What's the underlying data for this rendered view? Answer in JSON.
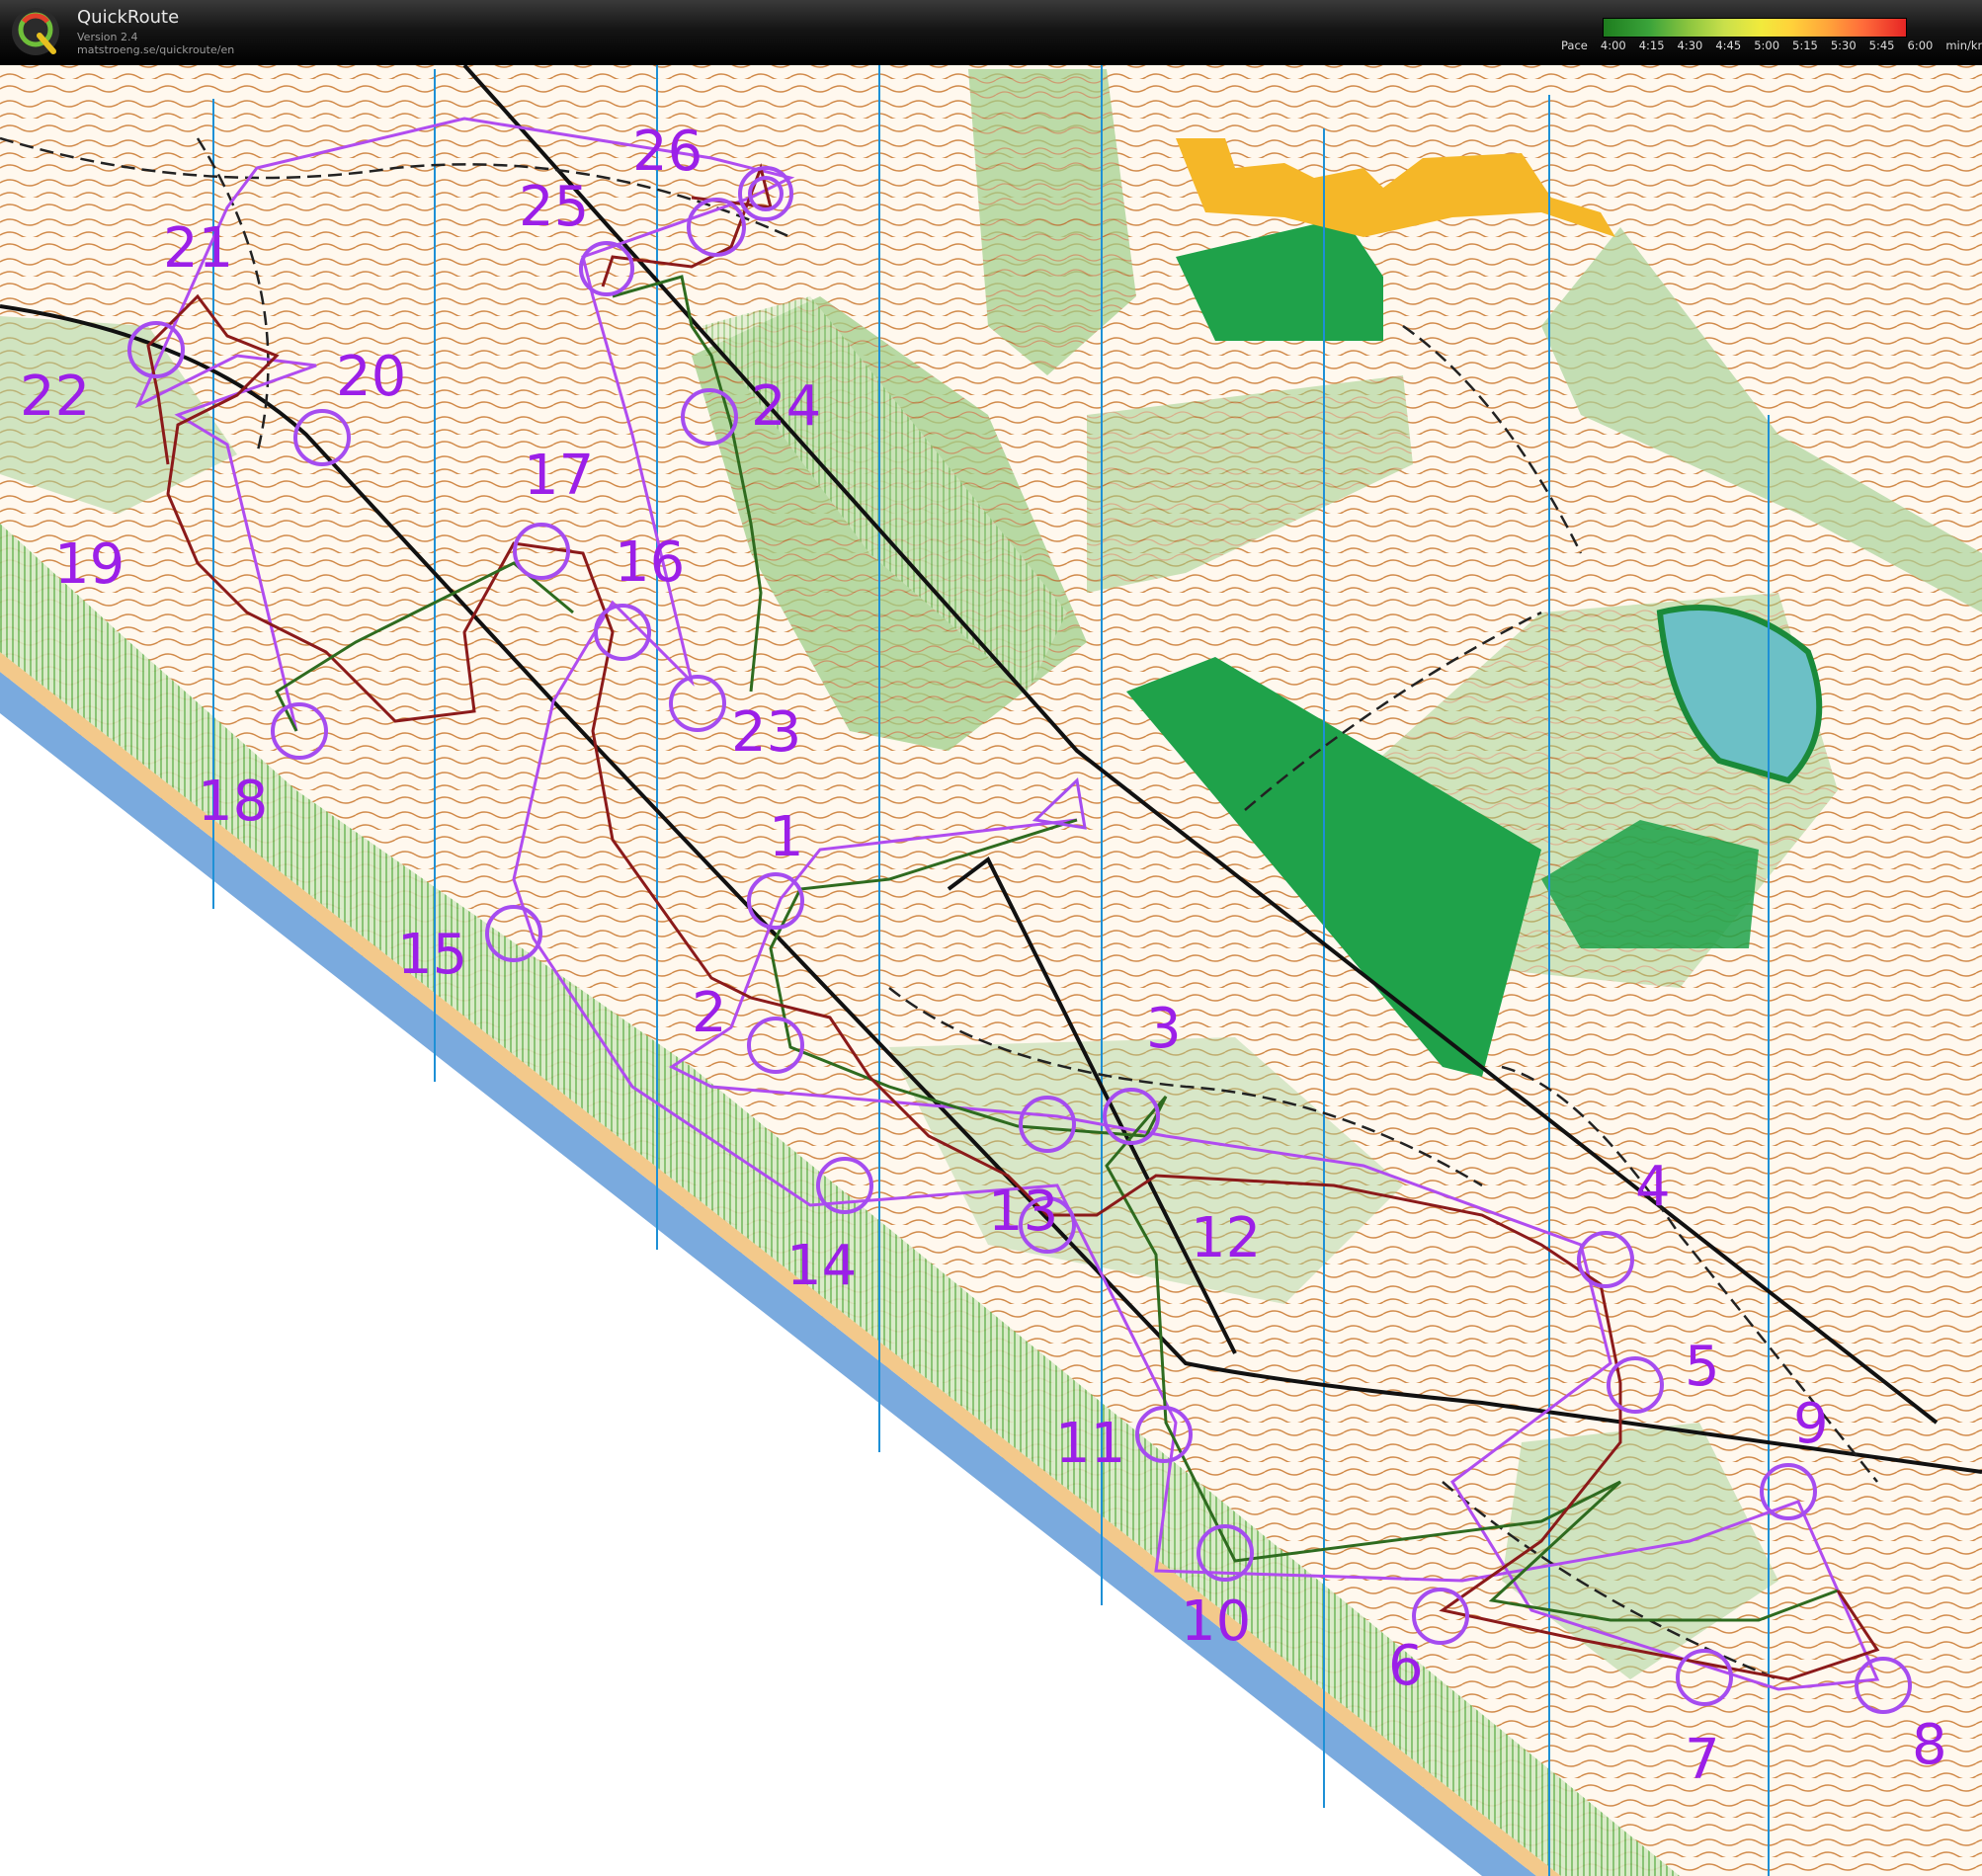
{
  "header": {
    "app_name": "QuickRoute",
    "version": "Version 2.4",
    "url": "matstroeng.se/quickroute/en"
  },
  "pace_legend": {
    "label": "Pace",
    "ticks": [
      "4:00",
      "4:15",
      "4:30",
      "4:45",
      "5:00",
      "5:15",
      "5:30",
      "5:45",
      "6:00"
    ],
    "unit": "min/km",
    "colors": [
      "#1e7d1e",
      "#3aa33a",
      "#8bc53f",
      "#c9e04b",
      "#f1ea3c",
      "#ffd23a",
      "#ffa53a",
      "#ff6b3a",
      "#e62525"
    ]
  },
  "map": {
    "type": "orienteering map",
    "colors": {
      "course": "#9b1fe8",
      "route": "#8b1a1a",
      "forest_green": "#1fa24a",
      "light_green": "#a9d39a",
      "contours": "#c0712e",
      "water_sea": "#7aaade",
      "open_land": "#f5b728",
      "north_lines": "#1e90d6"
    },
    "controls": [
      "1",
      "2",
      "3",
      "4",
      "5",
      "6",
      "7",
      "8",
      "9",
      "10",
      "11",
      "12",
      "13",
      "14",
      "15",
      "16",
      "17",
      "18",
      "19",
      "20",
      "21",
      "22",
      "23",
      "24",
      "25",
      "26"
    ]
  }
}
